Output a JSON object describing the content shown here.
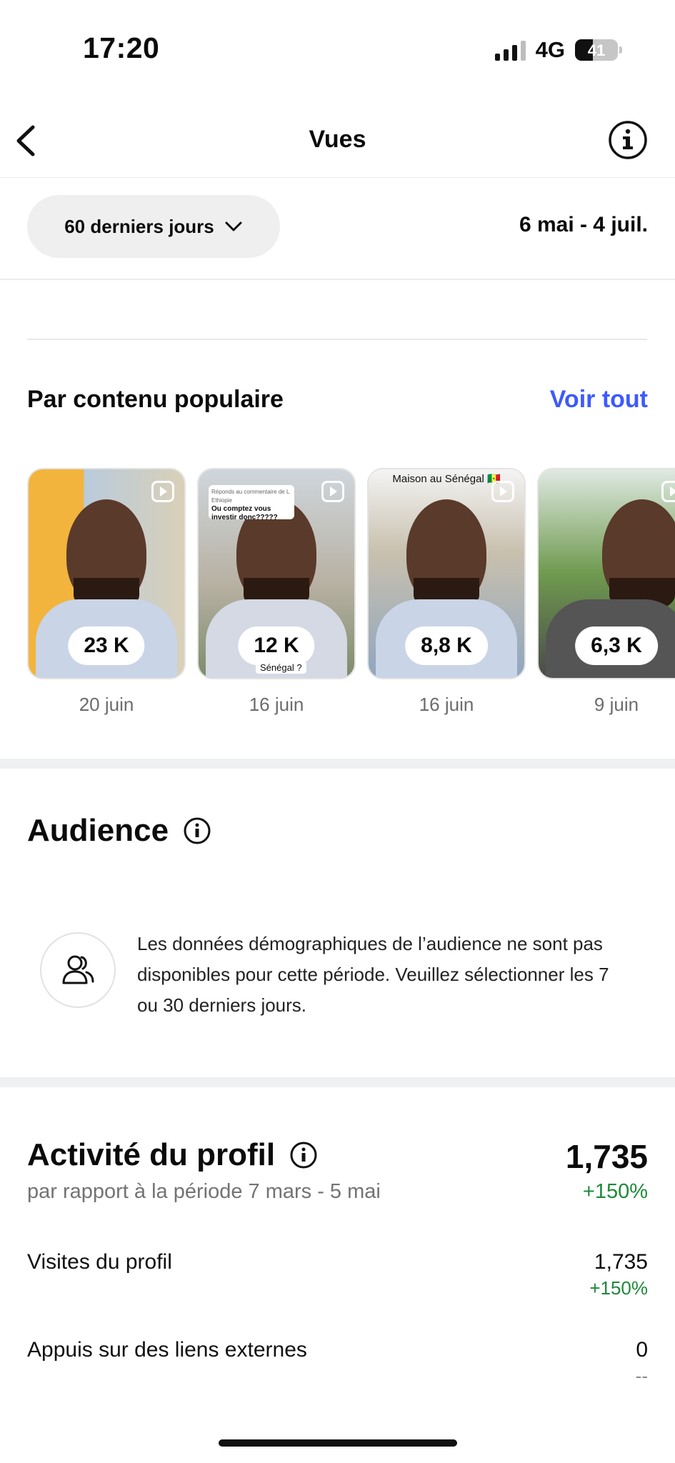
{
  "status": {
    "time": "17:20",
    "network": "4G",
    "battery": "41",
    "battery_level": 0.41
  },
  "nav": {
    "title": "Vues",
    "back_icon": "chevron-left-icon",
    "info_icon": "info-icon"
  },
  "filter": {
    "period": "60 derniers jours",
    "date_range": "6 mai - 4 juil."
  },
  "popular": {
    "title": "Par contenu populaire",
    "see_all": "Voir tout",
    "items": [
      {
        "views": "23 K",
        "date": "20 juin"
      },
      {
        "views": "12 K",
        "date": "16 juin",
        "comment_header": "Réponds au commentaire de L Ethiopie",
        "comment": "Ou comptez vous investir donc?????",
        "caption_bottom": "Sénégal ?"
      },
      {
        "views": "8,8 K",
        "date": "16 juin",
        "caption_top": "Maison au Sénégal 🇸🇳"
      },
      {
        "views": "6,3 K",
        "date": "9 juin"
      }
    ]
  },
  "audience": {
    "title": "Audience",
    "message": "Les données démographiques de l’audience ne sont pas disponibles pour cette période. Veuillez sélectionner les 7 ou 30 derniers jours."
  },
  "activity": {
    "title": "Activité du profil",
    "subtitle": "par rapport à la période 7 mars - 5 mai",
    "total": "1,735",
    "change": "+150%",
    "rows": [
      {
        "label": "Visites du profil",
        "value": "1,735",
        "change": "+150%"
      },
      {
        "label": "Appuis sur des liens externes",
        "value": "0",
        "change": "--"
      }
    ]
  },
  "colors": {
    "accent": "#3d5afe",
    "positive": "#1f8a3a"
  }
}
